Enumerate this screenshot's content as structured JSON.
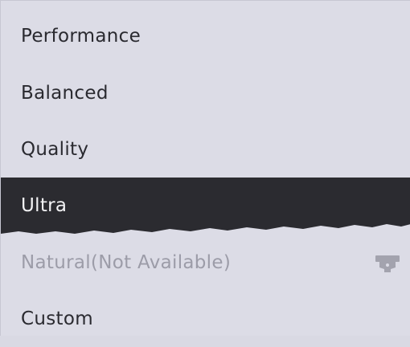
{
  "menu": {
    "items": [
      {
        "label": "Performance",
        "state": "normal"
      },
      {
        "label": "Balanced",
        "state": "normal"
      },
      {
        "label": "Quality",
        "state": "normal"
      },
      {
        "label": "Ultra",
        "state": "selected"
      },
      {
        "label": "Natural(Not Available)",
        "state": "disabled",
        "icon": "lock-icon"
      },
      {
        "label": "Custom",
        "state": "normal"
      }
    ]
  },
  "colors": {
    "background": "#dcdce6",
    "selected_background": "#2b2b30",
    "text": "#2a2a30",
    "disabled_text": "#9c9ca8"
  }
}
